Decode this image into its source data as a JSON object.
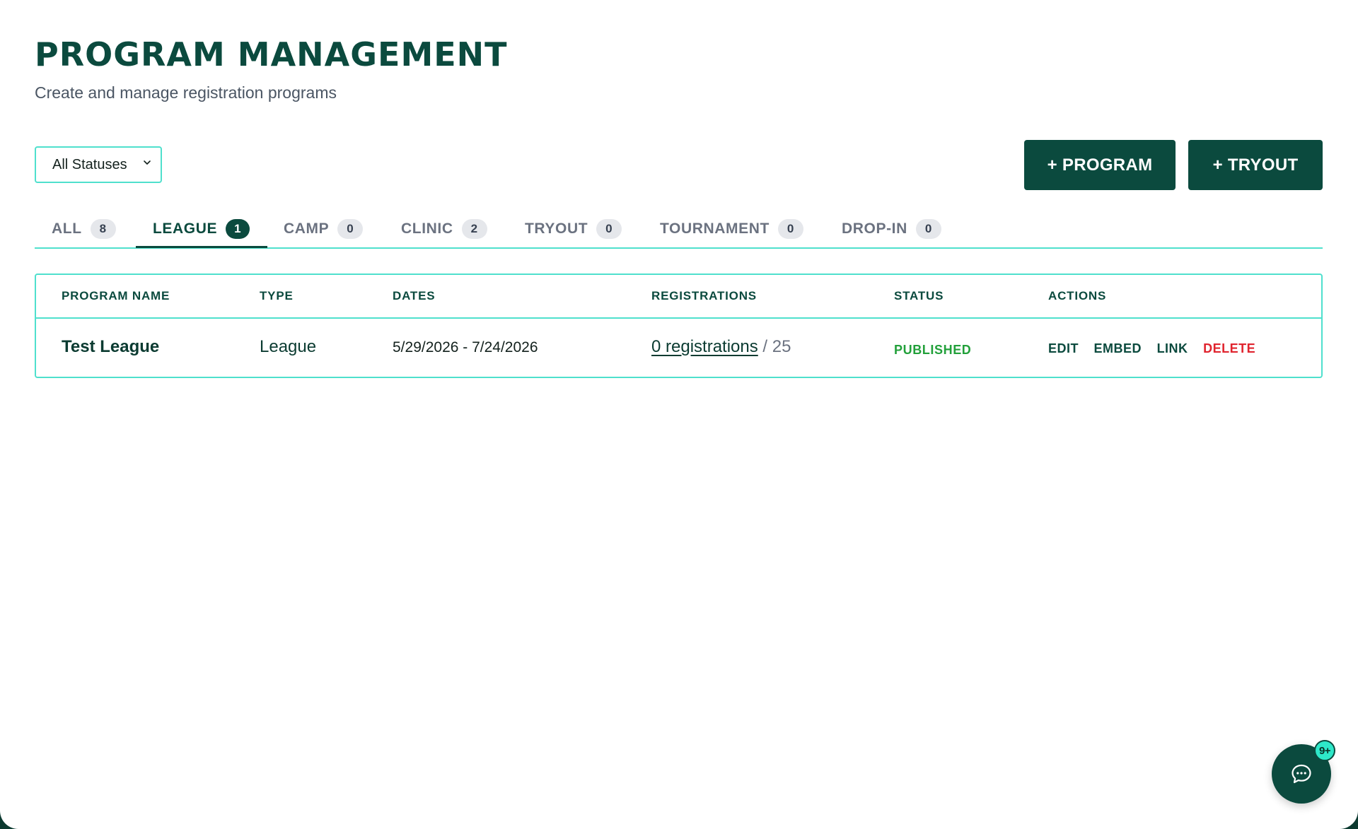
{
  "header": {
    "title": "PROGRAM MANAGEMENT",
    "subtitle": "Create and manage registration programs"
  },
  "filters": {
    "status_selected": "All Statuses"
  },
  "toolbar": {
    "add_program_label": "+ PROGRAM",
    "add_tryout_label": "+ TRYOUT"
  },
  "tabs": [
    {
      "label": "ALL",
      "count": "8",
      "active": false
    },
    {
      "label": "LEAGUE",
      "count": "1",
      "active": true
    },
    {
      "label": "CAMP",
      "count": "0",
      "active": false
    },
    {
      "label": "CLINIC",
      "count": "2",
      "active": false
    },
    {
      "label": "TRYOUT",
      "count": "0",
      "active": false
    },
    {
      "label": "TOURNAMENT",
      "count": "0",
      "active": false
    },
    {
      "label": "DROP-IN",
      "count": "0",
      "active": false
    }
  ],
  "table": {
    "columns": [
      "PROGRAM NAME",
      "TYPE",
      "DATES",
      "REGISTRATIONS",
      "STATUS",
      "ACTIONS"
    ],
    "rows": [
      {
        "name": "Test League",
        "type": "League",
        "dates": "5/29/2026 - 7/24/2026",
        "registrations_link": "0 registrations",
        "registrations_cap": " / 25",
        "status": "PUBLISHED",
        "actions": [
          "EDIT",
          "EMBED",
          "LINK",
          "DELETE"
        ]
      }
    ]
  },
  "chat": {
    "icon": "chat-bubble-icon",
    "badge": "9+"
  },
  "colors": {
    "primary": "#0b4a3e",
    "accent_border": "#4fe0cd",
    "status_published": "#22a03a",
    "danger": "#e0242e",
    "badge_bg": "#2ee8c9"
  }
}
